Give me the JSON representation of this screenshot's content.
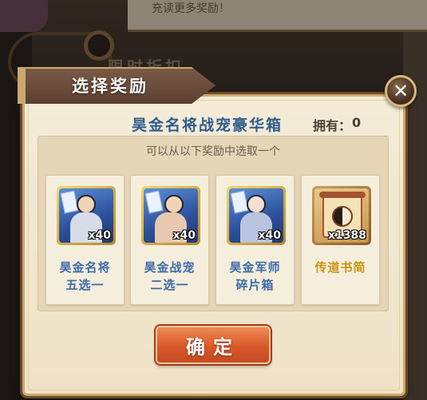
{
  "dialog": {
    "title": "选择奖励",
    "box_name": "昊金名将战宠豪华箱",
    "own_label": "拥有：",
    "own_value": "0",
    "hint": "可以从以下奖励中选取一个",
    "confirm_label": "确定",
    "close_symbol": "✕"
  },
  "rewards": [
    {
      "name_line1": "昊金名将",
      "name_line2": "五选一",
      "qty": "x40",
      "icon": "hero-card-icon",
      "color": "#3d6aa8"
    },
    {
      "name_line1": "昊金战宠",
      "name_line2": "二选一",
      "qty": "x40",
      "icon": "pet-card-icon",
      "color": "#3d6aa8"
    },
    {
      "name_line1": "昊金军师",
      "name_line2": "碎片箱",
      "qty": "x40",
      "icon": "strategist-card-icon",
      "color": "#3d6aa8"
    },
    {
      "name_line1": "传道书简",
      "name_line2": "",
      "qty": "x1388",
      "icon": "scroll-icon",
      "color": "#c89412"
    }
  ],
  "background": {
    "top_text": "充读更多奖励！",
    "tab_text": "限时折扣"
  }
}
